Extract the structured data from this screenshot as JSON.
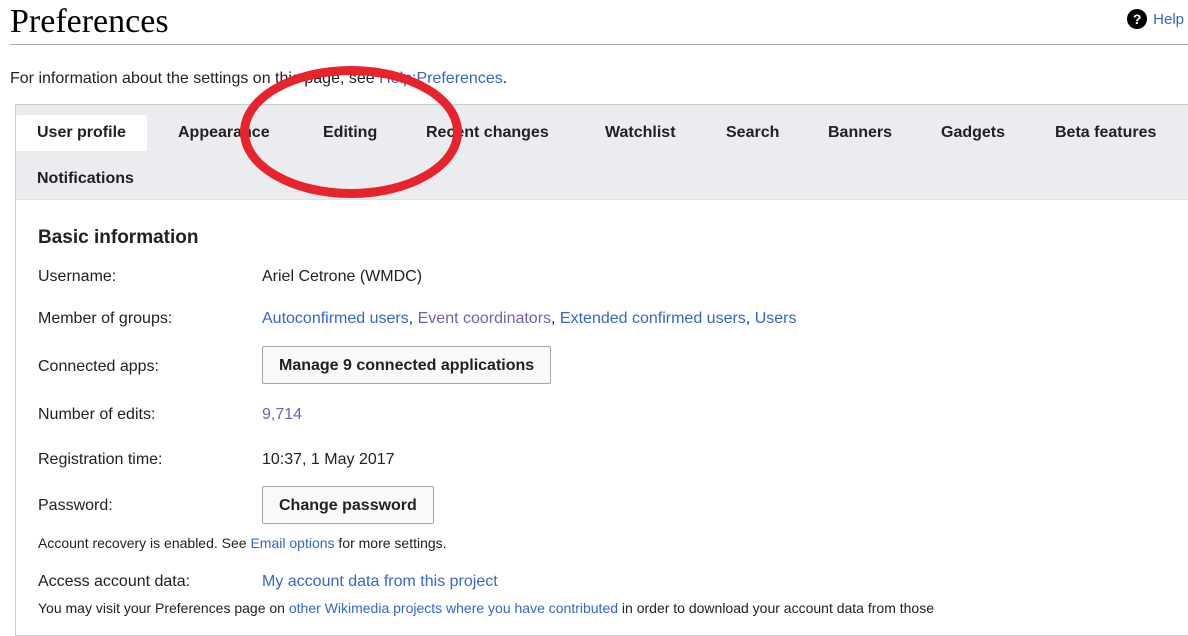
{
  "header": {
    "title": "Preferences",
    "help_label": "Help",
    "help_icon": "question-circle-icon"
  },
  "intro": {
    "before": "For information about the settings on this page, see ",
    "link": "Help:Preferences",
    "after": "."
  },
  "tabs": [
    {
      "label": "User profile",
      "active": true
    },
    {
      "label": "Appearance",
      "active": false
    },
    {
      "label": "Editing",
      "active": false
    },
    {
      "label": "Recent changes",
      "active": false
    },
    {
      "label": "Watchlist",
      "active": false
    },
    {
      "label": "Search",
      "active": false
    },
    {
      "label": "Banners",
      "active": false
    },
    {
      "label": "Gadgets",
      "active": false
    },
    {
      "label": "Beta features",
      "active": false
    },
    {
      "label": "Notifications",
      "active": false
    }
  ],
  "basic": {
    "section_title": "Basic information",
    "username_label": "Username:",
    "username_value": "Ariel Cetrone (WMDC)",
    "groups_label": "Member of groups:",
    "groups": [
      {
        "name": "Autoconfirmed users",
        "sep": ", "
      },
      {
        "name": "Event coordinators",
        "sep": ", "
      },
      {
        "name": "Extended confirmed users",
        "sep": ", "
      },
      {
        "name": "Users",
        "sep": ""
      }
    ],
    "apps_label": "Connected apps:",
    "apps_button": "Manage 9 connected applications",
    "edits_label": "Number of edits:",
    "edits_value": "9,714",
    "registration_label": "Registration time:",
    "registration_value": "10:37, 1 May 2017",
    "password_label": "Password:",
    "password_button": "Change password",
    "recovery_before": "Account recovery is enabled. See ",
    "recovery_link": "Email options",
    "recovery_after": " for more settings.",
    "access_label": "Access account data:",
    "access_link": "My account data from this project",
    "visit_before": "You may visit your Preferences page on ",
    "visit_link": "other Wikimedia projects where you have contributed",
    "visit_after": " in order to download your account data from those"
  },
  "colors": {
    "link": "#3366cc",
    "visited_link": "#795cb2",
    "annotation_circle": "#e8232b",
    "tabbar_bg": "#eaecf0"
  }
}
